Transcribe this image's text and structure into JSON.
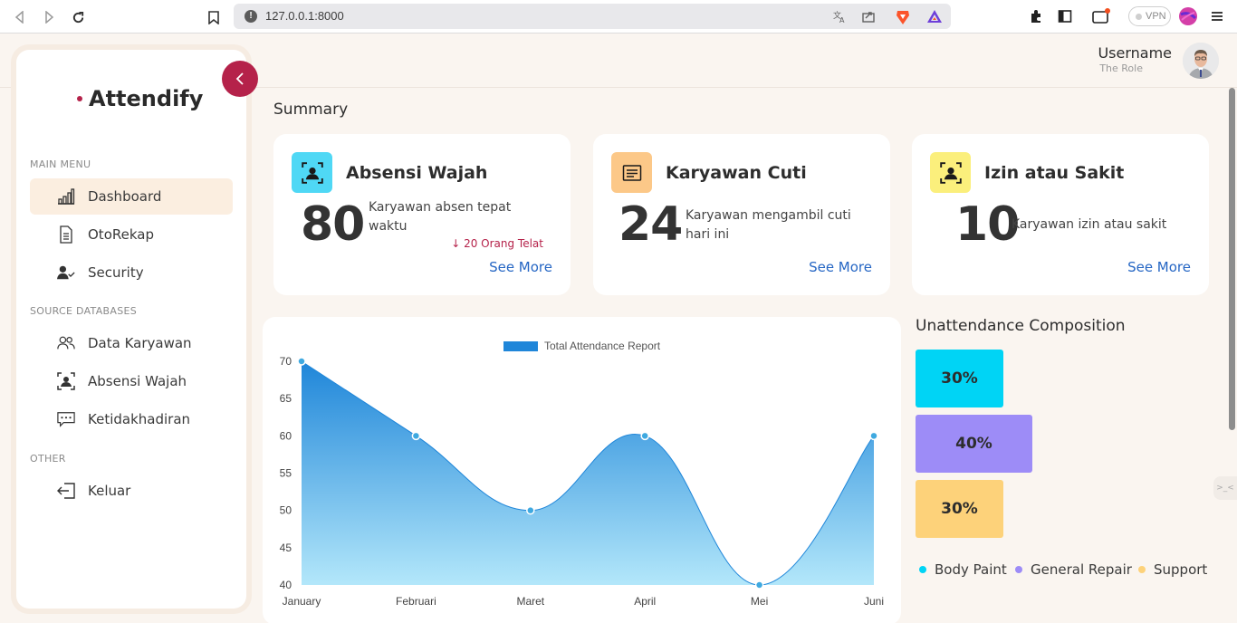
{
  "browser": {
    "url": "127.0.0.1:8000",
    "vpn_label": "VPN"
  },
  "header": {
    "username": "Username",
    "role": "The Role"
  },
  "sidebar": {
    "logo": "Attendify",
    "sections": [
      {
        "title": "MAIN MENU",
        "items": [
          {
            "label": "Dashboard",
            "icon": "bar-chart-icon",
            "active": true
          },
          {
            "label": "OtoRekap",
            "icon": "document-icon"
          },
          {
            "label": "Security",
            "icon": "user-check-icon"
          }
        ]
      },
      {
        "title": "SOURCE DATABASES",
        "items": [
          {
            "label": "Data Karyawan",
            "icon": "users-icon"
          },
          {
            "label": "Absensi Wajah",
            "icon": "face-scan-icon"
          },
          {
            "label": "Ketidakhadiran",
            "icon": "message-dots-icon"
          }
        ]
      },
      {
        "title": "OTHER",
        "items": [
          {
            "label": "Keluar",
            "icon": "logout-icon"
          }
        ]
      }
    ]
  },
  "summary": {
    "title": "Summary",
    "cards": [
      {
        "title": "Absensi Wajah",
        "value": "80",
        "desc": "Karyawan absen tepat waktu",
        "note": "↓ 20 Orang Telat",
        "link": "See More",
        "color": "#4fd8f5"
      },
      {
        "title": "Karyawan Cuti",
        "value": "24",
        "desc": "Karyawan mengambil cuti hari ini",
        "link": "See More",
        "color": "#fcc888"
      },
      {
        "title": "Izin atau Sakit",
        "value": "10",
        "desc": "Karyawan izin atau sakit",
        "link": "See More",
        "color": "#fbef7c"
      }
    ]
  },
  "chart_data": {
    "type": "area",
    "categories": [
      "January",
      "Februari",
      "Maret",
      "April",
      "Mei",
      "Juni"
    ],
    "series": [
      {
        "name": "Total Attendance Report",
        "values": [
          70,
          60,
          50,
          60,
          40,
          60
        ]
      }
    ],
    "yticks": [
      70,
      65,
      60,
      55,
      50,
      45,
      40
    ],
    "ylim": [
      40,
      70
    ],
    "legend": "top-center",
    "color": "#1f86d9"
  },
  "composition": {
    "title": "Unattendance Composition",
    "items": [
      {
        "label": "Body Paint",
        "value": "30%",
        "color": "#00d4f5"
      },
      {
        "label": "General Repair",
        "value": "40%",
        "color": "#9d8cf7"
      },
      {
        "label": "Support",
        "value": "30%",
        "color": "#fdd27a"
      }
    ]
  }
}
